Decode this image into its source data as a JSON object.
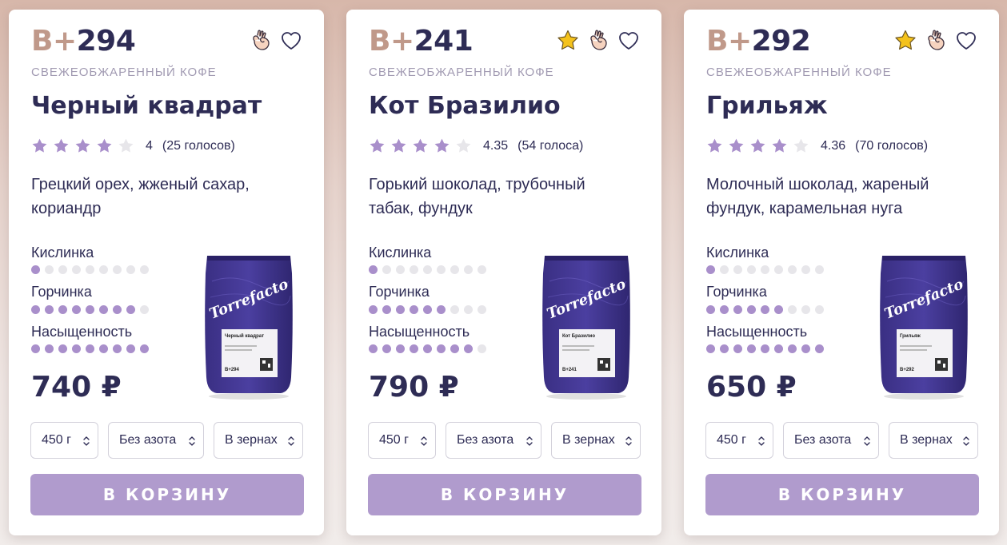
{
  "colors": {
    "brand_dark": "#2e2c55",
    "accent_purple": "#b09bcd",
    "dot_on": "#a98fcb",
    "dot_off": "#e7e6ea",
    "code_prefix": "#c0998a",
    "star_gold": "#f4c21b"
  },
  "labels": {
    "acidity": "Кислинка",
    "bitterness": "Горчинка",
    "saturation": "Насыщенность"
  },
  "products": [
    {
      "code_prefix": "В+",
      "code_number": "294",
      "category": "СВЕЖЕОБЖАРЕННЫЙ КОФЕ",
      "name": "Черный квадрат",
      "starred": false,
      "rating_value": "4",
      "rating_stars": 4,
      "votes": "(25 голосов)",
      "description": "Грецкий орех, жженый сахар, кориандр",
      "acidity": 1,
      "bitterness": 8,
      "saturation": 9,
      "price": "740 ₽",
      "weight": "450 г",
      "nitrogen": "Без азота",
      "grind": "В зернах",
      "cart_label": "В КОРЗИНУ",
      "pack_brand": "Torrefacto",
      "pack_name": "Черный квадрат",
      "pack_code": "B+294"
    },
    {
      "code_prefix": "В+",
      "code_number": "241",
      "category": "СВЕЖЕОБЖАРЕННЫЙ КОФЕ",
      "name": "Кот Бразилио",
      "starred": true,
      "rating_value": "4.35",
      "rating_stars": 4,
      "votes": "(54 голоса)",
      "description": "Горький шоколад, трубочный табак, фундук",
      "acidity": 1,
      "bitterness": 6,
      "saturation": 8,
      "price": "790 ₽",
      "weight": "450 г",
      "nitrogen": "Без азота",
      "grind": "В зернах",
      "cart_label": "В КОРЗИНУ",
      "pack_brand": "Torrefacto",
      "pack_name": "Кот Бразилио",
      "pack_code": "B+241"
    },
    {
      "code_prefix": "В+",
      "code_number": "292",
      "category": "СВЕЖЕОБЖАРЕННЫЙ КОФЕ",
      "name": "Грильяж",
      "starred": true,
      "rating_value": "4.36",
      "rating_stars": 4,
      "votes": "(70 голосов)",
      "description": "Молочный шоколад, жареный фундук, карамельная нуга",
      "acidity": 1,
      "bitterness": 6,
      "saturation": 9,
      "price": "650 ₽",
      "weight": "450 г",
      "nitrogen": "Без азота",
      "grind": "В зернах",
      "cart_label": "В КОРЗИНУ",
      "pack_brand": "Torrefacto",
      "pack_name": "Грильяж",
      "pack_code": "B+292"
    }
  ]
}
